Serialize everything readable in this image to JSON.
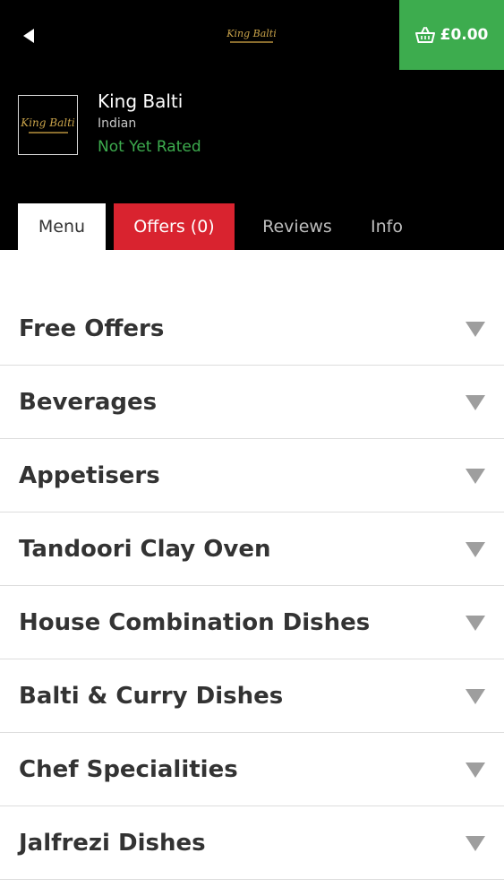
{
  "header": {
    "back_icon": "back-arrow-icon",
    "logo_text": "King Balti",
    "basket": {
      "icon": "basket-icon",
      "total": "£0.00",
      "color": "#3dac4e"
    }
  },
  "restaurant": {
    "logo_text": "King Balti",
    "name": "King Balti",
    "cuisine": "Indian",
    "rating": "Not Yet Rated"
  },
  "tabs": [
    {
      "label": "Menu",
      "active": true
    },
    {
      "label": "Offers (0)",
      "highlight_color": "#d9232f"
    },
    {
      "label": "Reviews"
    },
    {
      "label": "Info"
    }
  ],
  "categories": [
    {
      "label": "Free Offers",
      "icon": "chevron-down-icon"
    },
    {
      "label": "Beverages",
      "icon": "chevron-down-icon"
    },
    {
      "label": "Appetisers",
      "icon": "chevron-down-icon"
    },
    {
      "label": "Tandoori Clay Oven",
      "icon": "chevron-down-icon"
    },
    {
      "label": "House Combination Dishes",
      "icon": "chevron-down-icon"
    },
    {
      "label": "Balti & Curry Dishes",
      "icon": "chevron-down-icon"
    },
    {
      "label": "Chef Specialities",
      "icon": "chevron-down-icon"
    },
    {
      "label": "Jalfrezi Dishes",
      "icon": "chevron-down-icon"
    }
  ]
}
